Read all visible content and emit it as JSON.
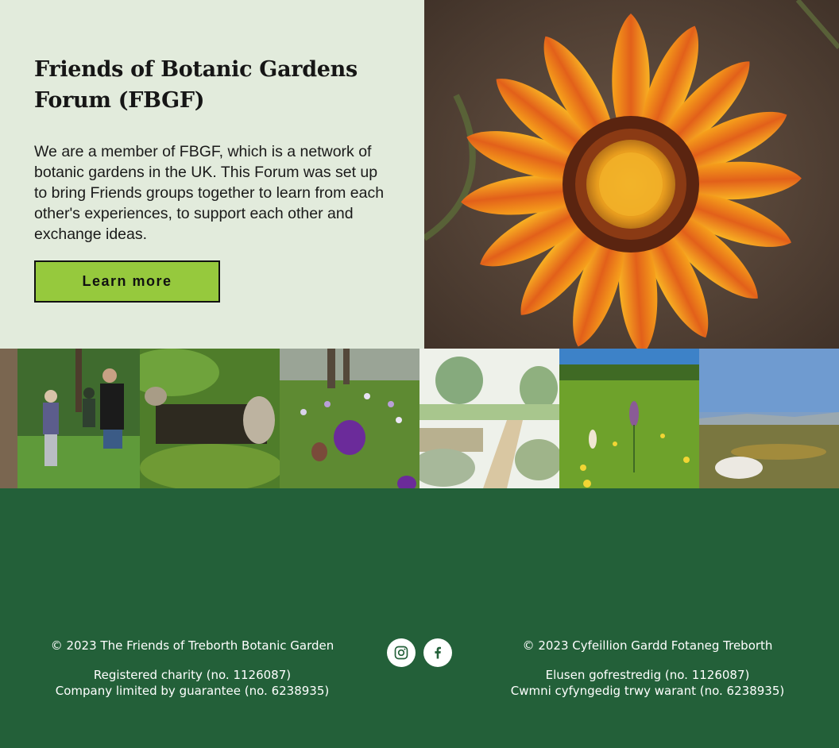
{
  "hero": {
    "title": "Friends of Botanic Gardens Forum (FBGF)",
    "body": "We are a member of FBGF, which is a network of botanic gardens in the UK. This Forum was set up to bring Friends groups together to learn from each other's experiences, to support each other and exchange ideas.",
    "button_label": "Learn more",
    "image_alt_icon": "gazania-flower-photo"
  },
  "gallery": {
    "items": [
      {
        "icon": "volunteers-photo"
      },
      {
        "icon": "rockery-photo"
      },
      {
        "icon": "crocus-photo"
      },
      {
        "icon": "garden-painting-photo"
      },
      {
        "icon": "orchid-meadow-photo"
      },
      {
        "icon": "coastal-view-photo"
      }
    ]
  },
  "footer": {
    "left": {
      "copyright": "© 2023 The Friends of Treborth Botanic Garden",
      "charity": "Registered charity (no. 1126087)",
      "company": "Company limited by guarantee (no. 6238935)"
    },
    "right": {
      "copyright": "© 2023 Cyfeillion Gardd Fotaneg Treborth",
      "charity": "Elusen gofrestredig (no. 1126087)",
      "company": "Cwmni cyfyngedig trwy warant (no. 6238935)"
    },
    "social": {
      "instagram_icon": "instagram-icon",
      "facebook_icon": "facebook-icon"
    }
  },
  "colors": {
    "hero_bg": "#e2ebdc",
    "button_bg": "#96c93d",
    "footer_bg": "#236039"
  }
}
